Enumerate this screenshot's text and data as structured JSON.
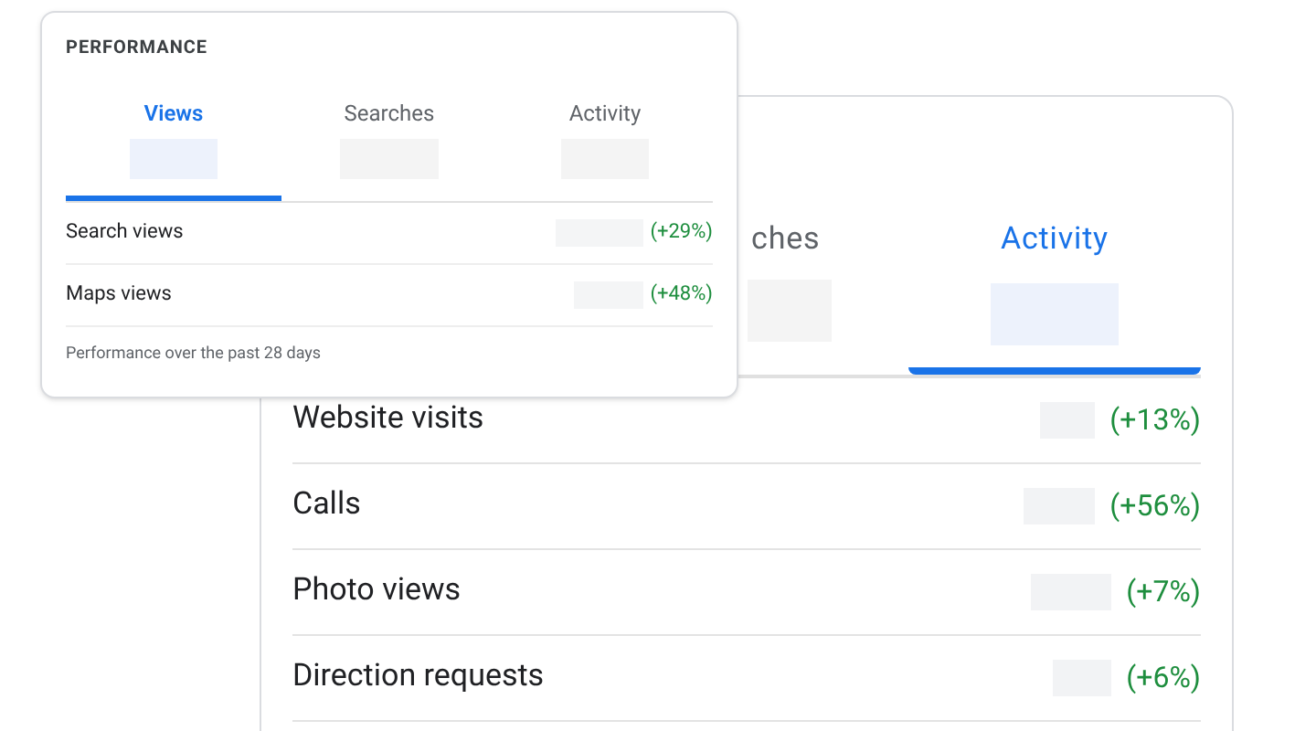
{
  "back_card": {
    "tabs": [
      {
        "label": "ches",
        "selected": false
      },
      {
        "label": "Activity",
        "selected": true
      }
    ],
    "rows": [
      {
        "label": "Website visits",
        "change": "(+13%)"
      },
      {
        "label": "Calls",
        "change": "(+56%)"
      },
      {
        "label": "Photo views",
        "change": "(+7%)"
      },
      {
        "label": "Direction requests",
        "change": "(+6%)"
      }
    ]
  },
  "front_card": {
    "title": "PERFORMANCE",
    "tabs": [
      {
        "label": "Views",
        "selected": true
      },
      {
        "label": "Searches",
        "selected": false
      },
      {
        "label": "Activity",
        "selected": false
      }
    ],
    "rows": [
      {
        "label": "Search views",
        "change": "(+29%)"
      },
      {
        "label": "Maps views",
        "change": "(+48%)"
      }
    ],
    "footer": "Performance over the past 28 days"
  }
}
